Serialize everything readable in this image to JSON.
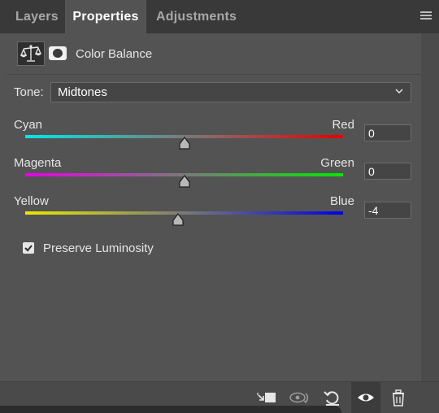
{
  "tabs": [
    {
      "label": "Layers"
    },
    {
      "label": "Properties"
    },
    {
      "label": "Adjustments"
    }
  ],
  "active_tab": "Properties",
  "header": {
    "icon": "scales-icon",
    "mask_icon": "layer-mask-icon",
    "title": "Color Balance"
  },
  "tone": {
    "label": "Tone:",
    "value": "Midtones"
  },
  "sliders": [
    {
      "left": "Cyan",
      "right": "Red",
      "value": "0",
      "numeric": 0,
      "min": -100,
      "max": 100,
      "gradient": [
        "#00e8e8",
        "#e80000"
      ]
    },
    {
      "left": "Magenta",
      "right": "Green",
      "value": "0",
      "numeric": 0,
      "min": -100,
      "max": 100,
      "gradient": [
        "#e800e8",
        "#00e800"
      ]
    },
    {
      "left": "Yellow",
      "right": "Blue",
      "value": "-4",
      "numeric": -4,
      "min": -100,
      "max": 100,
      "gradient": [
        "#e8e800",
        "#0000e8"
      ]
    }
  ],
  "preserve_luminosity": {
    "label": "Preserve Luminosity",
    "checked": true
  },
  "toolbar": {
    "buttons": [
      "clip-to-layer-icon",
      "view-previous-state-icon",
      "reset-icon",
      "visibility-eye-icon",
      "trash-icon"
    ]
  }
}
